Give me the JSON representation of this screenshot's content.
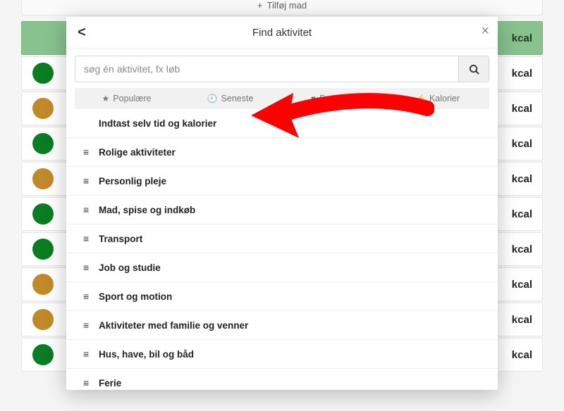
{
  "bg": {
    "top_label": "Tilføj mad",
    "unit": "kcal"
  },
  "modal": {
    "title": "Find aktivitet",
    "back": "<",
    "close": "×",
    "search": {
      "placeholder": "søg én aktivitet, fx løb"
    },
    "tabs": [
      {
        "icon": "★",
        "label": "Populære"
      },
      {
        "icon": "🕘",
        "label": "Seneste"
      },
      {
        "icon": "♥",
        "label": "Favoritter"
      },
      {
        "icon": "⚡",
        "label": "Kalorier"
      }
    ],
    "items": [
      {
        "special": true,
        "label": "Indtast selv tid og kalorier"
      },
      {
        "label": "Rolige aktiviteter"
      },
      {
        "label": "Personlig pleje"
      },
      {
        "label": "Mad, spise og indkøb"
      },
      {
        "label": "Transport"
      },
      {
        "label": "Job og studie"
      },
      {
        "label": "Sport og motion"
      },
      {
        "label": "Aktiviteter med familie og venner"
      },
      {
        "label": "Hus, have, bil og båd"
      },
      {
        "label": "Ferie"
      }
    ]
  },
  "rows": [
    {
      "type": "head"
    },
    {
      "color": "green"
    },
    {
      "color": "olive"
    },
    {
      "color": "green"
    },
    {
      "color": "olive"
    },
    {
      "color": "green"
    },
    {
      "color": "green"
    },
    {
      "color": "olive"
    },
    {
      "color": "olive"
    },
    {
      "color": "green"
    }
  ]
}
